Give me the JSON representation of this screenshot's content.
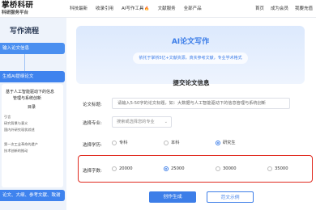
{
  "header": {
    "logo": "掌桥科研",
    "logo_sub": "科研服务平台",
    "nav": [
      "科技最新",
      "收录引用",
      "AI写作工具",
      "文献服务",
      "全部产品"
    ],
    "nav_hot": "🔥",
    "right": [
      "首页",
      "成为会员",
      "我要充值"
    ]
  },
  "sidebar": {
    "title": "写作流程",
    "step1": "输入论文信息",
    "step2": "生成AI提纲论文",
    "paper_title": "基于人工智能驱动下的信息",
    "paper_title2": "管理与系统创新",
    "paper_toc": "目录",
    "paper_lines": [
      "引言",
      "研究背景与意义",
      "国内外研究现状综述",
      "第一次工业革命的遗产",
      "技术创新的推动"
    ],
    "step3": "论文、大纲、参考文献、致谢"
  },
  "hero": {
    "title": "AI论文写作",
    "subtitle": "依托于掌桥5亿+文献资源，真实参考文献，专业学术格式"
  },
  "form": {
    "section_title": "提交论文信息",
    "title_label": "论文标题:",
    "title_value": "请输入5-50字的论文标题，如：大数据与人工智能驱动下的信息管理与系统创新",
    "major_label": "选择专业:",
    "major_placeholder": "搜索或选择您的专业",
    "degree_label": "选择学历:",
    "degrees": [
      "专科",
      "本科",
      "研究生"
    ],
    "degree_selected": 2,
    "words_label": "选择字数:",
    "words": [
      "20000",
      "25000",
      "30000",
      "35000"
    ],
    "words_selected": 1
  },
  "actions": {
    "create": "创作生成",
    "example": "范文示例"
  },
  "colors": {
    "accent": "#3d7ee8",
    "highlight": "#e02a1f"
  }
}
